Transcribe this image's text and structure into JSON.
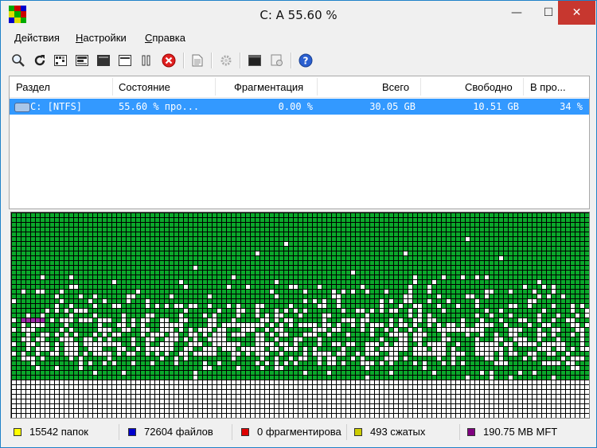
{
  "window": {
    "title": "C:  A  55.60 %",
    "minimize_glyph": "—",
    "maximize_glyph": "☐",
    "close_glyph": "✕"
  },
  "menu": [
    {
      "label": "Действия",
      "key": "Д"
    },
    {
      "label": "Настройки",
      "key": "Н"
    },
    {
      "label": "Справка",
      "key": "С"
    }
  ],
  "toolbar": {
    "icons": [
      "analyze-icon",
      "defragment-icon",
      "quick-optimize-icon",
      "full-optimize-icon",
      "mft-optimize-icon",
      "pause-icon",
      "stop-icon",
      "report-icon",
      "settings-icon",
      "boot-time-icon",
      "script-icon",
      "help-icon"
    ]
  },
  "volumes": {
    "columns": [
      "Раздел",
      "Состояние",
      "Фрагментация",
      "Всего",
      "Свободно",
      "В про..."
    ],
    "rows": [
      {
        "drive": "C: [NTFS]",
        "status": "55.60 % про...",
        "fragmentation": "0.00 %",
        "total": "30.05 GB",
        "free": "10.51 GB",
        "percent": "34 %"
      }
    ]
  },
  "legend": [
    {
      "label": "15542 папок",
      "color": "#ffff00"
    },
    {
      "label": "72604 файлов",
      "color": "#0000cc"
    },
    {
      "label": "0 фрагментирова",
      "color": "#dd0000"
    },
    {
      "label": "493 сжатых",
      "color": "#cccc00"
    },
    {
      "label": "190.75 MB MFT",
      "color": "#800080"
    }
  ],
  "colors": {
    "used": "#0aa82a",
    "free": "#ffffff",
    "mft": "#9a2aa6",
    "selection": "#3399ff",
    "close": "#c7372f"
  }
}
